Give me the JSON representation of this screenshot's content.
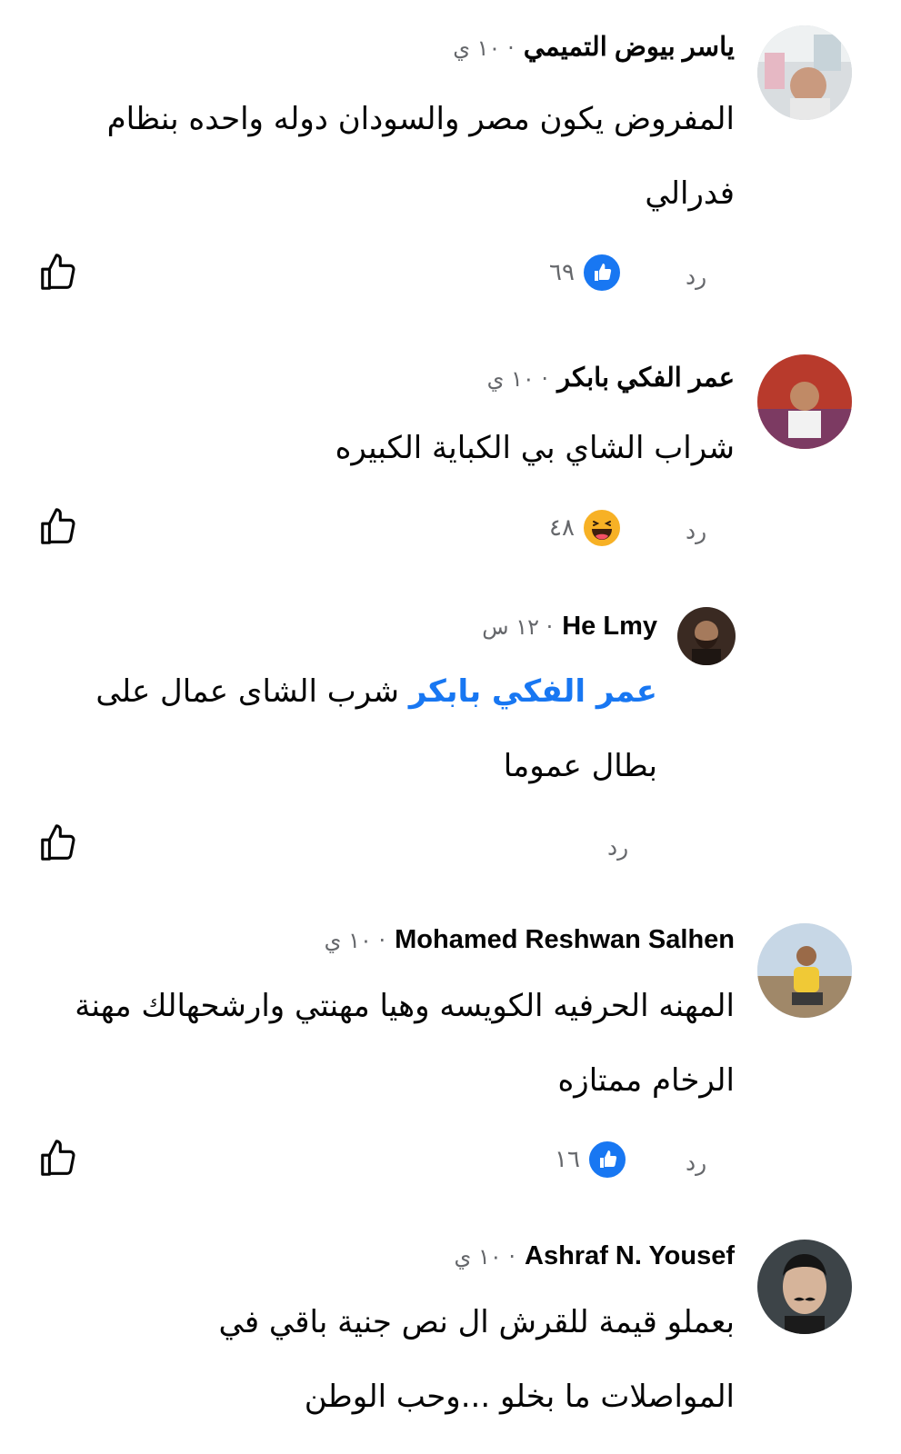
{
  "comments": [
    {
      "name": "ياسر بيوض التميمي",
      "time": "· ١٠ ي",
      "text": "المفروض يكون مصر والسودان دوله واحده بنظام فدرالي",
      "reply_label": "رد",
      "reaction_count": "٦٩",
      "reaction_icon": "like-icon",
      "avatar": "avatar-man-room"
    },
    {
      "name": "عمر الفكي بابكر",
      "time": "· ١٠ ي",
      "text": "شراب الشاي بي الكباية الكبيره",
      "reply_label": "رد",
      "reaction_count": "٤٨",
      "reaction_icon": "haha-icon",
      "avatar": "avatar-child"
    },
    {
      "name": "He Lmy",
      "time": "· ١٢ س",
      "mention": "عمر الفكي بابكر",
      "text": "شرب الشاى عمال على بطال عموما",
      "reply_label": "رد",
      "avatar": "avatar-bearded-man"
    },
    {
      "name": "Mohamed Reshwan Salhen",
      "time": "· ١٠ ي",
      "text": "المهنه الحرفيه الكويسه وهيا مهنتي وارشحهالك مهنة الرخام ممتازه",
      "reply_label": "رد",
      "reaction_count": "١٦",
      "reaction_icon": "like-icon",
      "avatar": "avatar-man-yellow-shirt"
    },
    {
      "name": "Ashraf N. Yousef",
      "time": "· ١٠ ي",
      "text": "بعملو قيمة للقرش ال نص جنية باقي في المواصلات ما بخلو ...وحب الوطن",
      "avatar": "avatar-man-mustache"
    }
  ],
  "colors": {
    "text": "#050505",
    "secondary": "#65676b",
    "link": "#1877f2",
    "like_blue": "#1877f2",
    "haha_yellow": "#f7b125"
  }
}
